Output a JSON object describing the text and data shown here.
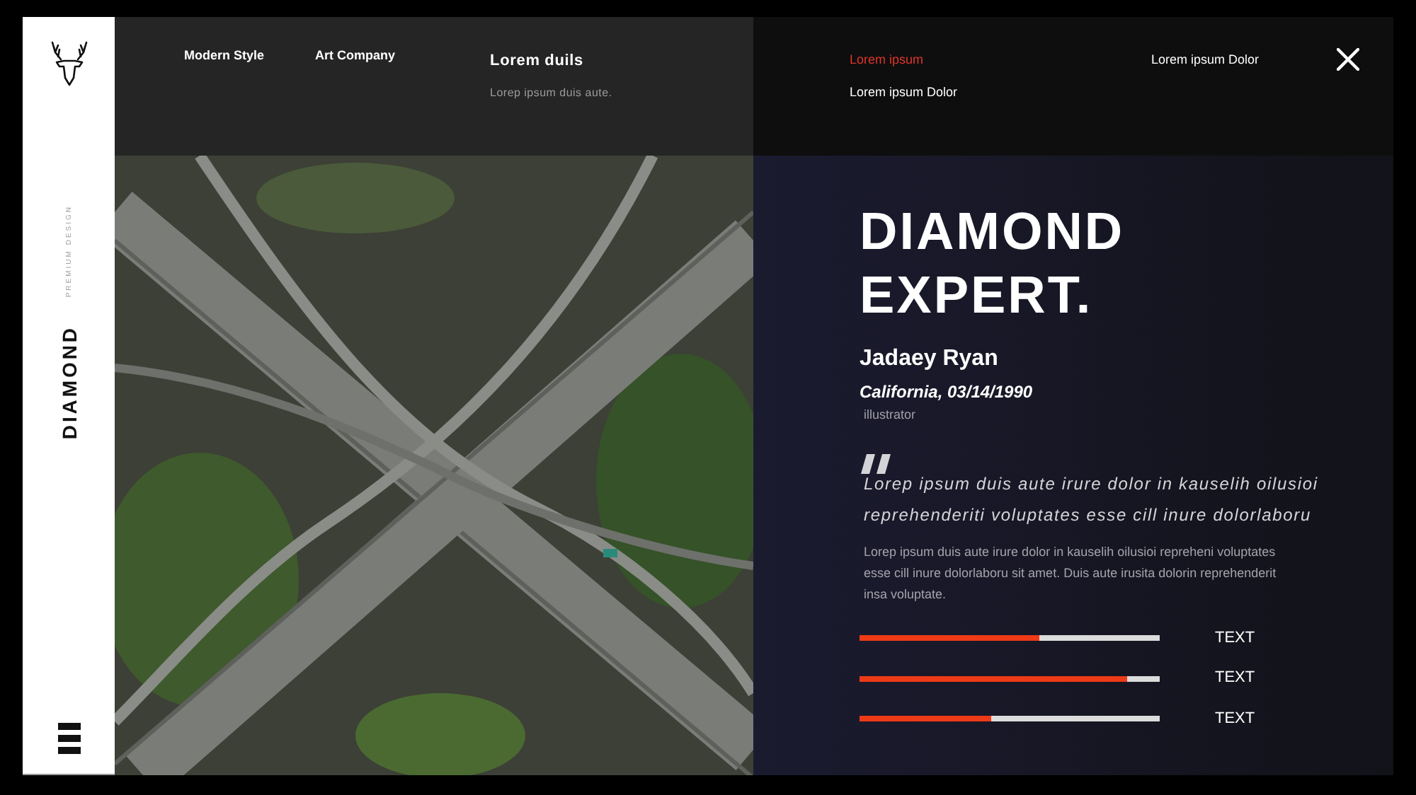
{
  "sidebar": {
    "tagline": "PREMIUM DESIGN",
    "brand": "DIAMOND"
  },
  "top_bar": {
    "links": [
      "Modern Style",
      "Art Company"
    ],
    "feature": {
      "title": "Lorem duils",
      "subtitle": "Lorep ipsum duis aute."
    },
    "menu": [
      {
        "label": "Lorem ipsum",
        "selected": true
      },
      {
        "label": "Lorem ipsum Dolor",
        "selected": false
      },
      {
        "label": "Lorem ipsum Dolor",
        "selected": false
      }
    ]
  },
  "hero": {
    "title_lines": [
      "DIAMOND",
      "EXPERT."
    ],
    "name": "Jadaey Ryan",
    "location_date": "California, 03/14/1990",
    "role": "illustrator",
    "quote": "Lorep ipsum duis aute irure dolor in kauselih oilusioi reprehenderiti voluptates esse cill inure dolorlaboru",
    "body": "Lorep ipsum duis aute irure dolor in kauselih oilusioi repreheni voluptates esse cill inure dolorlaboru sit amet. Duis aute irusita dolorin reprehenderit insa voluptate.",
    "skills": [
      {
        "label": "TEXT",
        "level": 0.6
      },
      {
        "label": "TEXT",
        "level": 0.89
      },
      {
        "label": "TEXT",
        "level": 0.44
      }
    ]
  }
}
